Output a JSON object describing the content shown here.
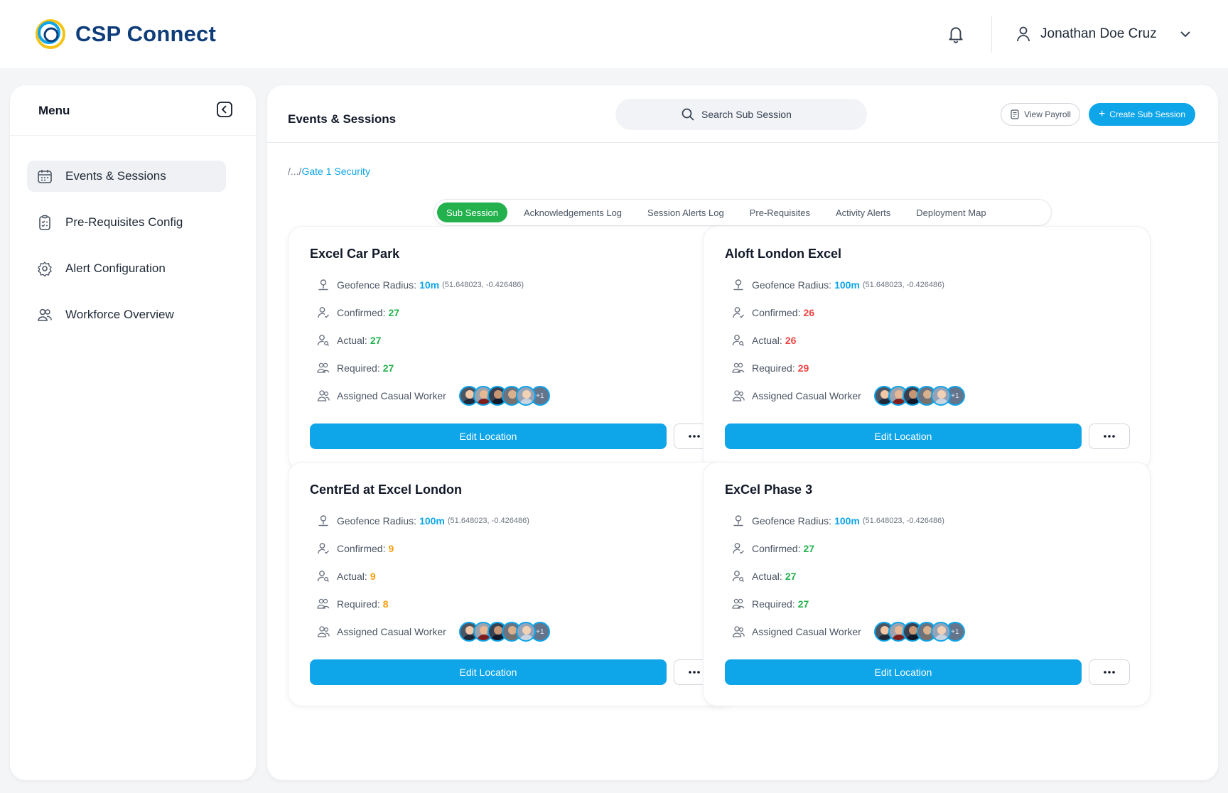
{
  "app": {
    "title": "CSP Connect"
  },
  "header": {
    "user_name": "Jonathan Doe Cruz"
  },
  "sidebar": {
    "title": "Menu",
    "items": [
      {
        "label": "Events & Sessions",
        "icon": "calendar-icon",
        "active": true
      },
      {
        "label": "Pre-Requisites Config",
        "icon": "clipboard-icon",
        "active": false
      },
      {
        "label": "Alert Configuration",
        "icon": "gear-icon",
        "active": false
      },
      {
        "label": "Workforce Overview",
        "icon": "users-icon",
        "active": false
      }
    ]
  },
  "main": {
    "title": "Events & Sessions",
    "search_placeholder": "Search Sub Session",
    "view_payroll_label": "View Payroll",
    "create_label": "Create Sub Session",
    "breadcrumb": {
      "prefix": "/.../",
      "current": "Gate 1 Security"
    },
    "tabs": [
      {
        "label": "Sub Session",
        "active": true
      },
      {
        "label": "Acknowledgements Log",
        "active": false
      },
      {
        "label": "Session Alerts Log",
        "active": false
      },
      {
        "label": "Pre-Requisites",
        "active": false
      },
      {
        "label": "Activity Alerts",
        "active": false
      },
      {
        "label": "Deployment Map",
        "active": false
      }
    ]
  },
  "labels": {
    "geofence": "Geofence Radius:",
    "confirmed": "Confirmed:",
    "actual": "Actual:",
    "required": "Required:",
    "assigned": "Assigned Casual Worker",
    "edit": "Edit Location",
    "more_count": "+1"
  },
  "colors": {
    "accent": "#0ea5e9",
    "green": "#22b14c",
    "red": "#ef4444",
    "orange": "#f59e0b"
  },
  "cards": [
    {
      "title": "Excel Car Park",
      "radius": "10m",
      "coords": "(51.648023, -0.426486)",
      "confirmed": "27",
      "actual": "27",
      "required": "27",
      "status_color": "#22b14c"
    },
    {
      "title": "Aloft London Excel",
      "radius": "100m",
      "coords": "(51.648023, -0.426486)",
      "confirmed": "26",
      "actual": "26",
      "required": "29",
      "status_color": "#ef4444"
    },
    {
      "title": "CentrEd at Excel London",
      "radius": "100m",
      "coords": "(51.648023, -0.426486)",
      "confirmed": "9",
      "actual": "9",
      "required": "8",
      "status_color": "#f59e0b"
    },
    {
      "title": "ExCel Phase 3",
      "radius": "100m",
      "coords": "(51.648023, -0.426486)",
      "confirmed": "27",
      "actual": "27",
      "required": "27",
      "status_color": "#22b14c"
    }
  ]
}
